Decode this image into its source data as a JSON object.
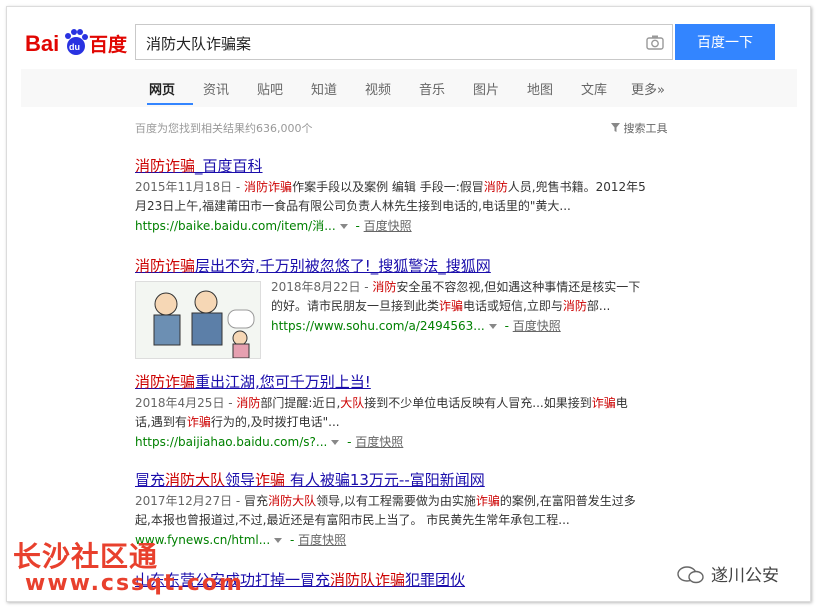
{
  "search": {
    "query": "消防大队诈骗案",
    "button": "百度一下",
    "logo_text": "Bai du 百度"
  },
  "tabs": [
    "网页",
    "资讯",
    "贴吧",
    "知道",
    "视频",
    "音乐",
    "图片",
    "地图",
    "文库",
    "更多»"
  ],
  "count_text": "百度为您找到相关结果约636,000个",
  "tools_text": "搜索工具",
  "results": [
    {
      "title_hl": "消防诈骗",
      "title_rest": "_百度百科",
      "date": "2015年11月18日 - ",
      "abs1_hl": "消防诈骗",
      "abs1_rest": "作案手段以及案例 编辑 手段一:假冒",
      "abs1_hl2": "消防",
      "abs1_rest2": "人员,兜售书籍。2012年5",
      "abs2": "月23日上午,福建莆田市一食品有限公司负责人林先生接到电话的,电话里的\"黄大...",
      "url": "https://baike.baidu.com/item/消...",
      "snap": "百度快照"
    },
    {
      "title_hl": "消防诈骗",
      "title_rest": "层出不穷,千万别被忽悠了!_搜狐警法_搜狐网",
      "date": "2018年8月22日 - ",
      "abs1_hl": "消防",
      "abs1_rest": "安全虽不容忽视,但如遇这种事情还是核实一下",
      "abs2_pre": "的好。请市民朋友一旦接到此类",
      "abs2_hl": "诈骗",
      "abs2_mid": "电话或短信,立即与",
      "abs2_hl2": "消防",
      "abs2_post": "部...",
      "url": "https://www.sohu.com/a/2494563...",
      "snap": "百度快照"
    },
    {
      "title_hl": "消防诈骗",
      "title_rest": "重出江湖,您可千万别上当!",
      "date": "2018年4月25日 - ",
      "abs1_hl": "消防",
      "abs1_rest": "部门提醒:近日,",
      "abs1_hl2": "大队",
      "abs1_rest2": "接到不少单位电话反映有人冒充...如果接到",
      "abs1_hl3": "诈骗",
      "abs1_rest3": "电",
      "abs2_pre": "话,遇到有",
      "abs2_hl": "诈骗",
      "abs2_post": "行为的,及时拨打电话\"...",
      "url": "https://baijiahao.baidu.com/s?...",
      "snap": "百度快照"
    },
    {
      "title_pre": "冒充",
      "title_hl": "消防大队",
      "title_mid": "领导",
      "title_hl2": "诈骗",
      "title_rest": " 有人被骗13万元--富阳新闻网",
      "date": "2017年12月27日 - ",
      "abs1_pre": "冒充",
      "abs1_hl": "消防大队",
      "abs1_rest": "领导,以有工程需要做为由实施",
      "abs1_hl2": "诈骗",
      "abs1_rest2": "的案例,在富阳普发生过多",
      "abs2": "起,本报也曾报道过,不过,最近还是有富阳市民上当了。 市民黄先生常年承包工程...",
      "url": "www.fynews.cn/html...",
      "snap": "百度快照"
    },
    {
      "title_pre": "山东东营公安成功打掉一冒充",
      "title_hl": "消防队诈骗",
      "title_rest": "犯罪团伙"
    }
  ],
  "watermark": {
    "left1": "长沙社区通",
    "left2": "www.cssqt.com",
    "right": "遂川公安"
  }
}
